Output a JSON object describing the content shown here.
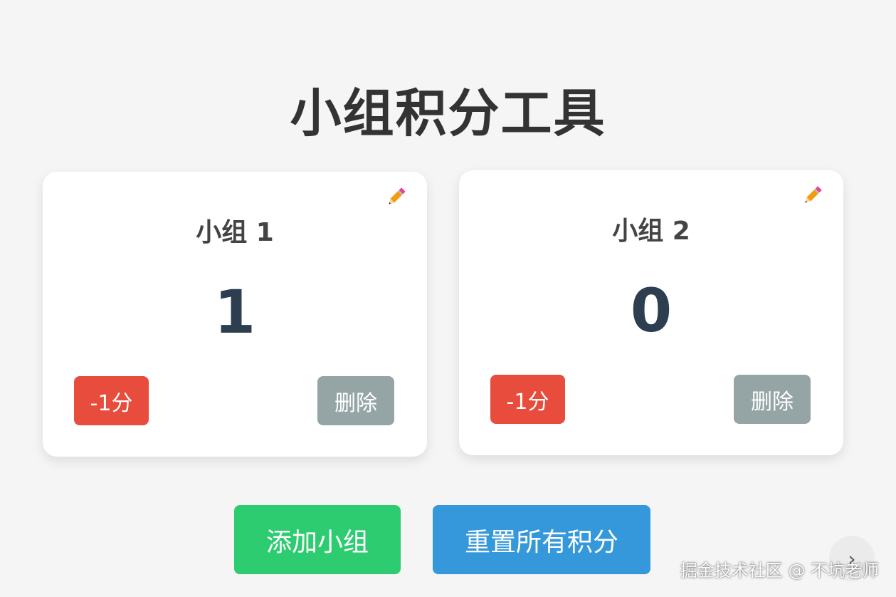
{
  "page": {
    "title": "小组积分工具"
  },
  "groups": [
    {
      "name": "小组 1",
      "score": "1",
      "minus_label": "-1分",
      "delete_label": "删除",
      "edit_icon": "pencil-icon"
    },
    {
      "name": "小组 2",
      "score": "0",
      "minus_label": "-1分",
      "delete_label": "删除",
      "edit_icon": "pencil-icon"
    }
  ],
  "actions": {
    "add_label": "添加小组",
    "reset_label": "重置所有积分"
  },
  "watermark": {
    "text": "掘金技术社区 @ 不坑老师"
  },
  "scroll": {
    "icon": "chevron-right-icon",
    "glyph": "›"
  },
  "colors": {
    "background": "#f5f5f5",
    "minus": "#e74c3c",
    "delete": "#95a5a6",
    "add": "#2ecc71",
    "reset": "#3498db",
    "score_text": "#2c3e50"
  }
}
